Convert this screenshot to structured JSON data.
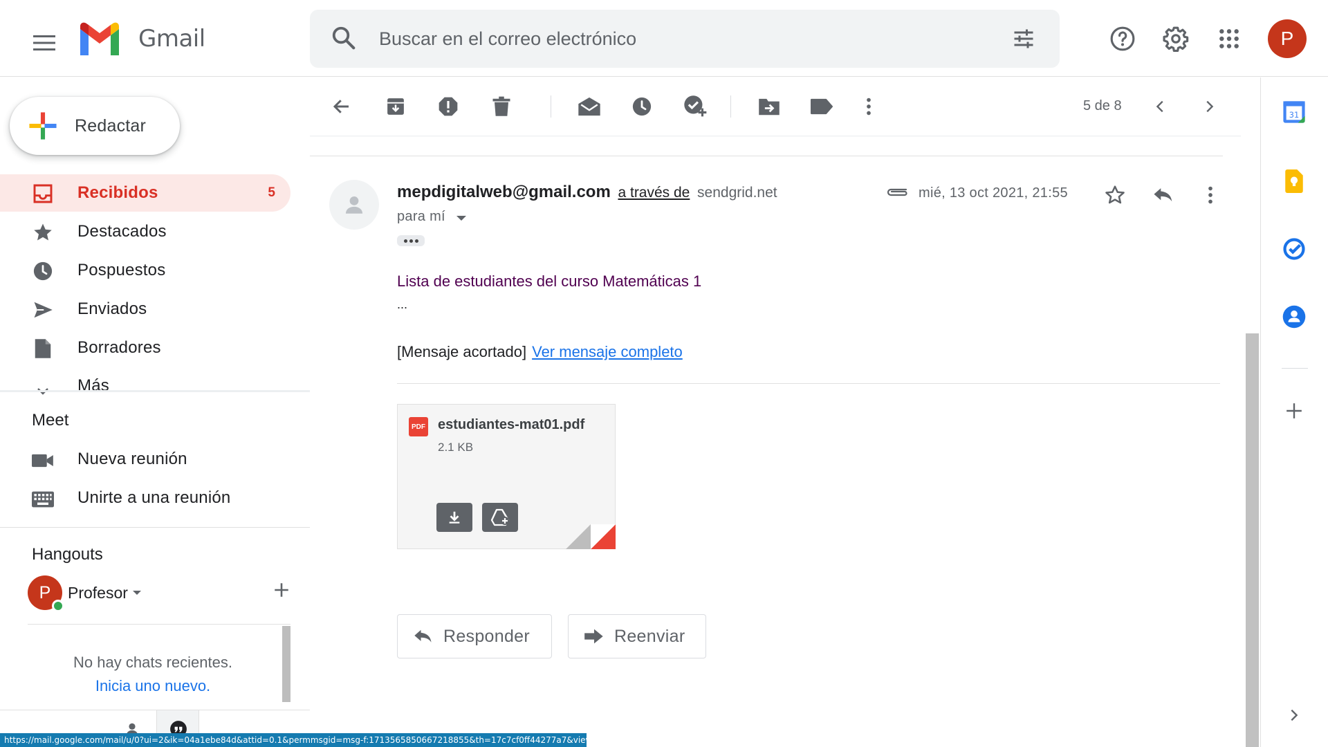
{
  "header": {
    "app_name": "Gmail",
    "search_placeholder": "Buscar en el correo electrónico",
    "avatar_letter": "P",
    "icons": [
      "menu-icon",
      "gmail-logo",
      "search-icon",
      "filter-icon",
      "help-icon",
      "gear-icon",
      "apps-grid-icon"
    ]
  },
  "sidebar": {
    "compose_label": "Redactar",
    "items": [
      {
        "label": "Recibidos",
        "count": "5",
        "icon": "inbox-icon",
        "active": true
      },
      {
        "label": "Destacados",
        "icon": "star-icon"
      },
      {
        "label": "Pospuestos",
        "icon": "clock-icon"
      },
      {
        "label": "Enviados",
        "icon": "send-icon"
      },
      {
        "label": "Borradores",
        "icon": "draft-icon"
      },
      {
        "label": "Más",
        "icon": "chevron-down-icon"
      }
    ],
    "meet": {
      "title": "Meet",
      "items": [
        {
          "label": "Nueva reunión",
          "icon": "video-icon"
        },
        {
          "label": "Unirte a una reunión",
          "icon": "keyboard-icon"
        }
      ]
    },
    "hangouts": {
      "title": "Hangouts",
      "user_letter": "P",
      "user_name": "Profesor",
      "empty_text": "No hay chats recientes.",
      "start_link": "Inicia uno nuevo."
    }
  },
  "toolbar": {
    "pager": "5 de 8",
    "icons": [
      "back-arrow-icon",
      "archive-icon",
      "report-spam-icon",
      "delete-icon",
      "mark-unread-icon",
      "snooze-icon",
      "add-task-icon",
      "move-to-icon",
      "label-icon",
      "more-vert-icon",
      "prev-icon",
      "next-icon"
    ]
  },
  "message": {
    "sender_email": "mepdigitalweb@gmail.com",
    "via_text": "a través de",
    "via_domain": "sendgrid.net",
    "to_label": "para mí",
    "date": "mié, 13 oct 2021, 21:55",
    "body_line1": "Lista de estudiantes del curso Matemáticas 1",
    "body_ellipsis": "...",
    "trimmed_text": "[Mensaje acortado]",
    "view_full_link": "Ver mensaje completo",
    "attachment": {
      "name": "estudiantes-mat01.pdf",
      "size": "2.1 KB",
      "badge": "PDF"
    },
    "reply_label": "Responder",
    "forward_label": "Reenviar"
  },
  "rail": {
    "calendar_day": "31",
    "icons": [
      "calendar-icon",
      "keep-icon",
      "tasks-icon",
      "contacts-icon",
      "add-icon",
      "chevron-right-icon"
    ]
  },
  "statusbar": {
    "url": "https://mail.google.com/mail/u/0?ui=2&ik=04a1ebe84d&attid=0.1&permmsgid=msg-f:1713565850667218855&th=17c7cf0ff44277a7&view=att&disp=inline"
  },
  "colors": {
    "accent_red": "#d93025",
    "active_bg": "#fce8e6",
    "link_blue": "#1a73e8",
    "avatar_red": "#c5361b",
    "online_green": "#34a853"
  }
}
